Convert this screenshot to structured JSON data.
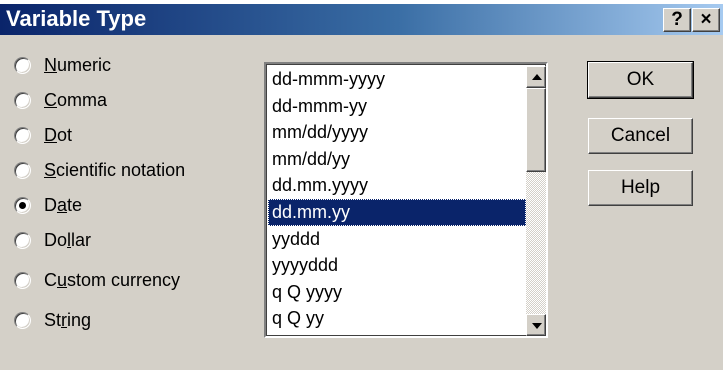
{
  "window": {
    "title": "Variable Type",
    "help_glyph": "?",
    "close_glyph": "×"
  },
  "type_options": [
    {
      "pre": "",
      "key": "N",
      "post": "umeric",
      "checked": false
    },
    {
      "pre": "",
      "key": "C",
      "post": "omma",
      "checked": false
    },
    {
      "pre": "",
      "key": "D",
      "post": "ot",
      "checked": false
    },
    {
      "pre": "",
      "key": "S",
      "post": "cientific notation",
      "checked": false
    },
    {
      "pre": "D",
      "key": "a",
      "post": "te",
      "checked": true
    },
    {
      "pre": "Do",
      "key": "l",
      "post": "lar",
      "checked": false
    },
    {
      "pre": "C",
      "key": "u",
      "post": "stom currency",
      "checked": false
    },
    {
      "pre": "St",
      "key": "r",
      "post": "ing",
      "checked": false
    }
  ],
  "date_formats": {
    "items": [
      "dd-mmm-yyyy",
      "dd-mmm-yy",
      "mm/dd/yyyy",
      "mm/dd/yy",
      "dd.mm.yyyy",
      "dd.mm.yy",
      "yyddd",
      "yyyyddd",
      "q Q yyyy",
      "q Q yy"
    ],
    "selected_index": 5
  },
  "buttons": {
    "ok": "OK",
    "cancel": "Cancel",
    "help": "Help"
  },
  "colors": {
    "title_gradient_start": "#0a246a",
    "title_gradient_end": "#a6caf0",
    "dialog_face": "#d4d0c8",
    "selection": "#0a246a"
  }
}
